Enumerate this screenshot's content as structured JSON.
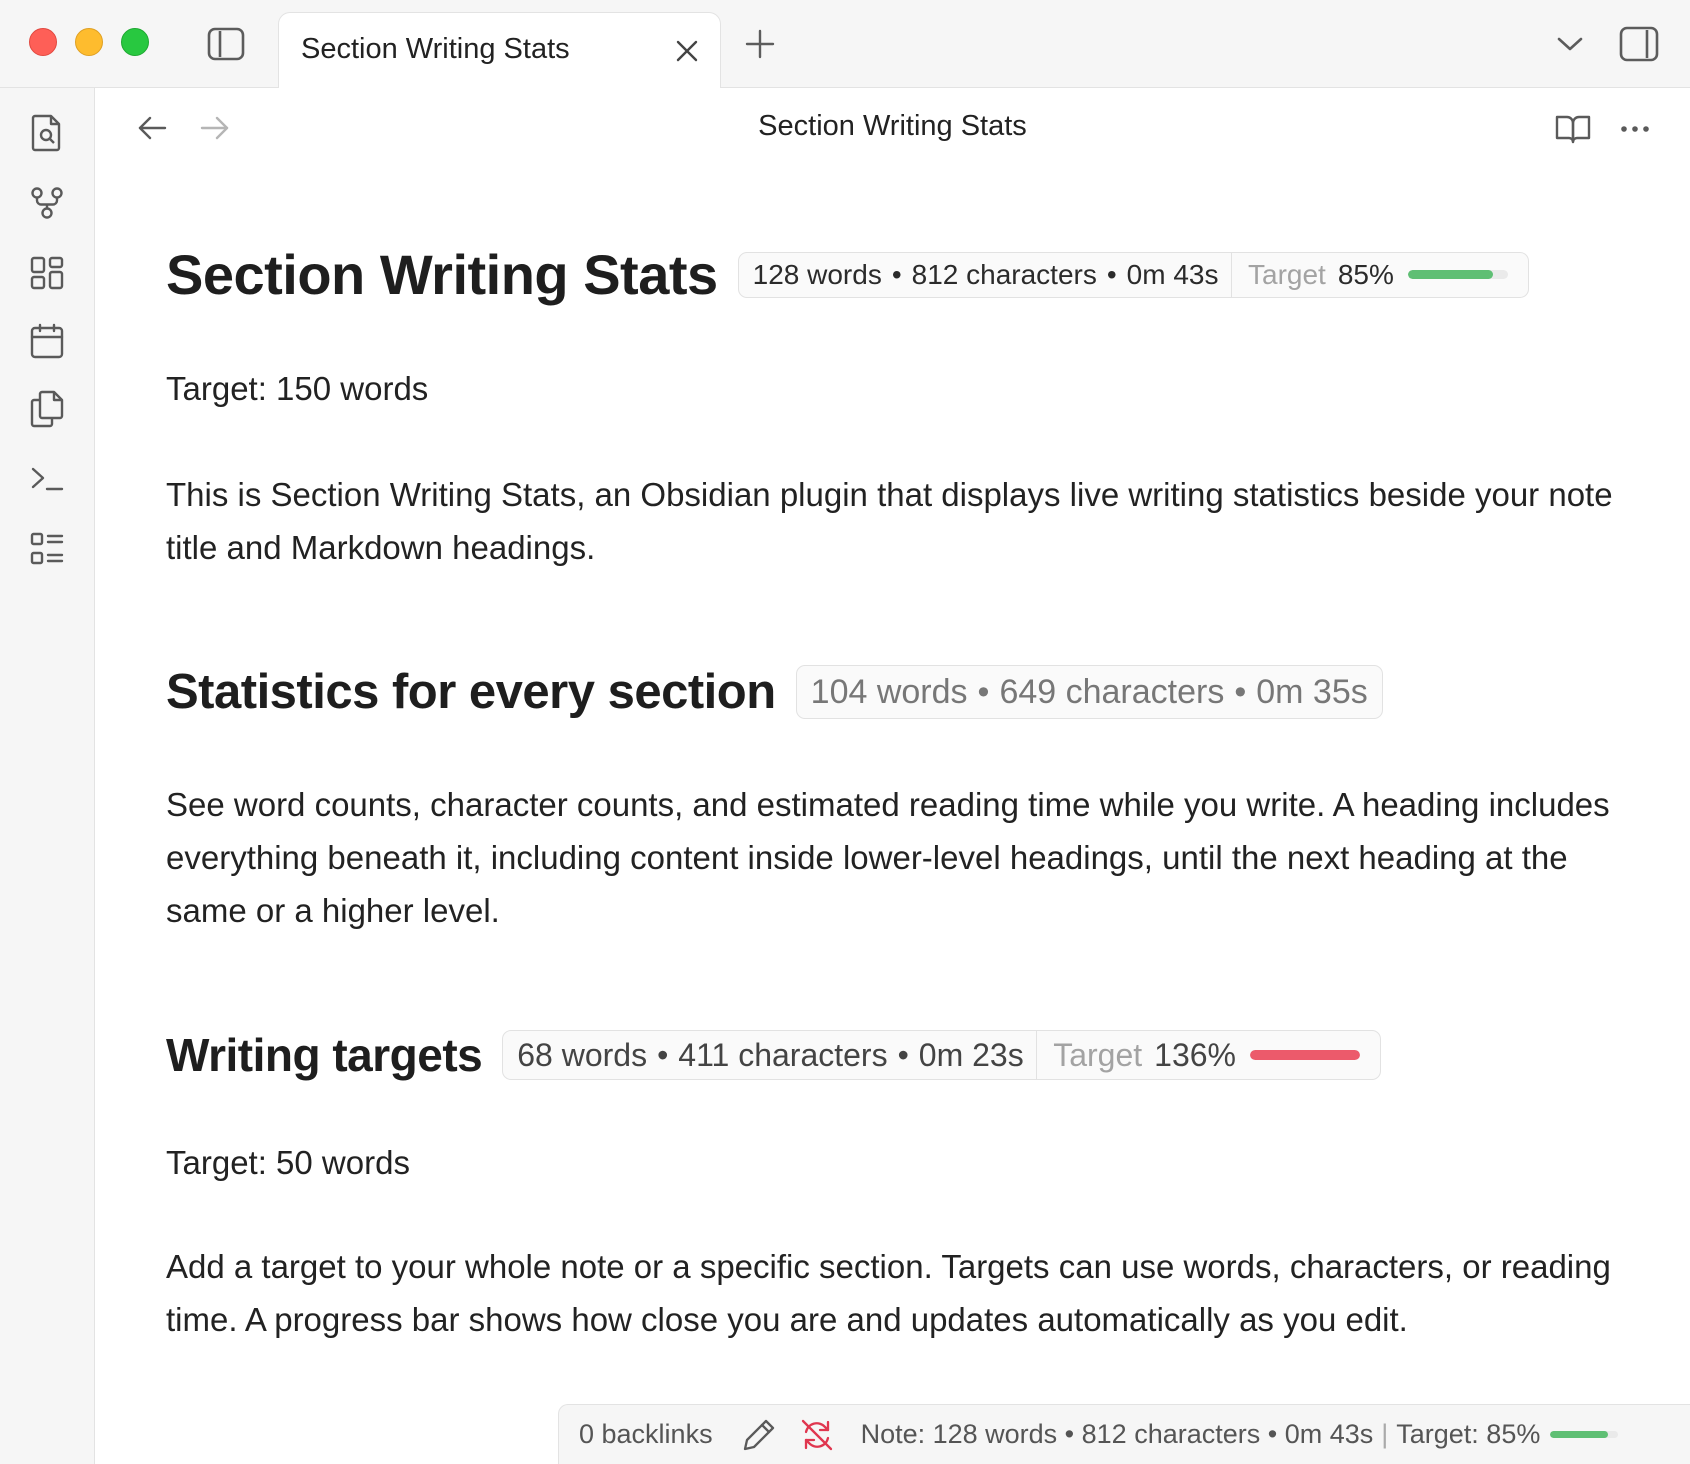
{
  "tab": {
    "title": "Section Writing Stats"
  },
  "view": {
    "title": "Section Writing Stats"
  },
  "ribbon": {
    "items": [
      {
        "name": "search-file-icon"
      },
      {
        "name": "graph-view-icon"
      },
      {
        "name": "canvas-icon"
      },
      {
        "name": "calendar-icon"
      },
      {
        "name": "templates-icon"
      },
      {
        "name": "command-palette-icon"
      },
      {
        "name": "outline-icon"
      }
    ]
  },
  "doc": {
    "title": "Section Writing Stats",
    "title_stats": {
      "words": "128 words",
      "chars": "812 characters",
      "time": "0m 43s",
      "target_label": "Target",
      "target_pct": "85%",
      "progress": 0.85,
      "bar_color": "#5fbf74"
    },
    "target_line_1": "Target: 150 words",
    "intro": "This is Section Writing Stats, an Obsidian plugin that displays live writing statistics beside your note title and Markdown headings.",
    "section_1": {
      "heading": "Statistics for every section",
      "words": "104 words",
      "chars": "649 characters",
      "time": "0m 35s",
      "body": "See word counts, character counts, and estimated reading time while you write. A heading includes everything beneath it, including content inside lower-level headings, until the next heading at the same or a higher level."
    },
    "section_2": {
      "heading": "Writing targets",
      "words": "68 words",
      "chars": "411 characters",
      "time": "0m 23s",
      "target_label": "Target",
      "target_pct": "136%",
      "progress": 1.0,
      "bar_color": "#ec5a6b",
      "target_line": "Target: 50 words",
      "body": "Add a target to your whole note or a specific section. Targets can use words, characters, or reading time. A progress bar shows how close you are and updates automatically as you edit."
    }
  },
  "statusbar": {
    "backlinks": "0 backlinks",
    "note_stats": "Note: 128 words • 812 characters • 0m 43s",
    "target": "Target: 85%",
    "progress": 0.85,
    "bar_color": "#5fbf74",
    "sync_color": "#e0364f"
  },
  "sep": "•",
  "pipe": "|"
}
